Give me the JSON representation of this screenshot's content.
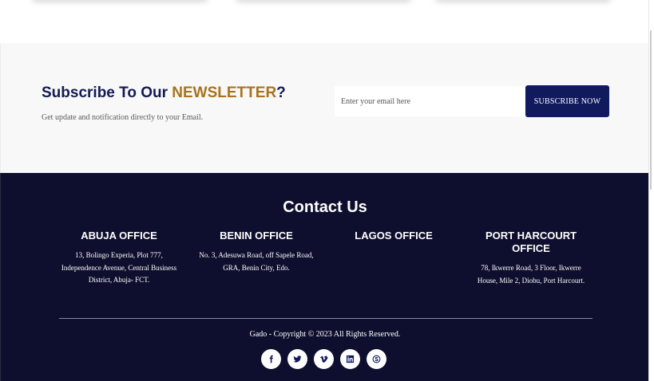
{
  "newsletter": {
    "title_prefix": "Subscribe To Our ",
    "title_accent": "NEWSLETTER",
    "title_suffix": "?",
    "subtitle": "Get update and notification directly to your Email.",
    "email_placeholder": "Enter your email here",
    "subscribe_label": "SUBSCRIBE NOW"
  },
  "footer": {
    "contact_title": "Contact Us",
    "offices": [
      {
        "name": "ABUJA OFFICE",
        "address": "13, Bolingo Experia, Plot 777, Independence Avenue, Central Business District, Abuja- FCT."
      },
      {
        "name": "BENIN OFFICE",
        "address": "No. 3, Adesuwa Road, off Sapele Road, GRA, Benin City, Edo."
      },
      {
        "name": "LAGOS OFFICE",
        "address": ""
      },
      {
        "name": "PORT HARCOURT OFFICE",
        "address": "78, Ikwerre Road, 3 Floor, Ikwerre House, Mile 2, Diobu, Port Harcourt."
      }
    ],
    "copyright": "Gado - Copyright © 2023 All Rights Reserved.",
    "socials": [
      "facebook-icon",
      "twitter-icon",
      "vimeo-icon",
      "linkedin-icon",
      "skype-icon"
    ]
  },
  "colors": {
    "brand_navy": "#121a5e",
    "accent_gold": "#a8731c",
    "footer_bg": "#0e0f2e",
    "newsletter_bg": "#f8f8f8"
  }
}
